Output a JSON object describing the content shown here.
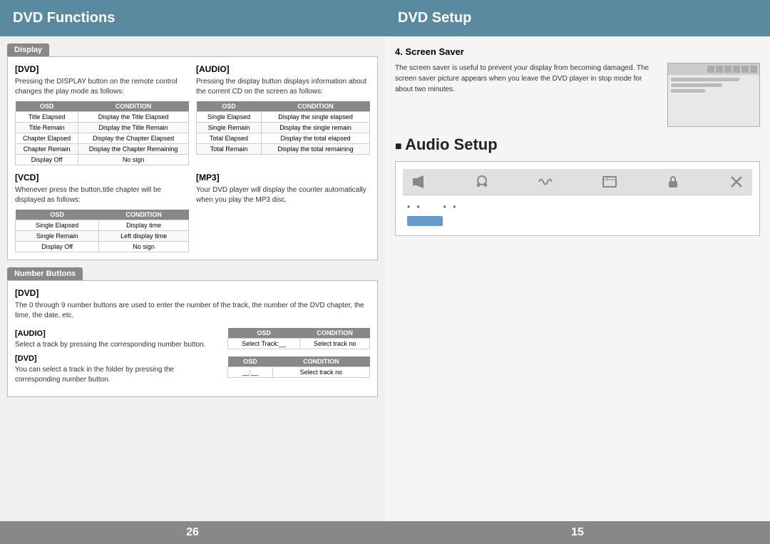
{
  "left": {
    "header": "DVD Functions",
    "display_tab": "Display",
    "dvd_title": "[DVD]",
    "dvd_desc": "Pressing the DISPLAY button on the remote control changes the play mode as follows:",
    "audio_title": "[AUDIO]",
    "audio_desc": "Pressing the display button displays information about the current CD on the screen as follows:",
    "dvd_table": {
      "headers": [
        "OSD",
        "CONDITION"
      ],
      "rows": [
        [
          "Title Elapsed",
          "Display the Title Elapsed"
        ],
        [
          "Title Remain",
          "Display the Title Remain"
        ],
        [
          "Chapter Elapsed",
          "Display the Chapter Elapsed"
        ],
        [
          "Chapter Remain",
          "Display the Chapter Remaining"
        ],
        [
          "Display Off",
          "No sign"
        ]
      ]
    },
    "audio_table": {
      "headers": [
        "OSD",
        "CONDITION"
      ],
      "rows": [
        [
          "Single Elapsed",
          "Display the single elapsed"
        ],
        [
          "Single Remain",
          "Display the single remain"
        ],
        [
          "Total Elapsed",
          "Display the total elapsed"
        ],
        [
          "Total Remain",
          "Display the total remaining"
        ]
      ]
    },
    "vcd_title": "[VCD]",
    "vcd_desc": "Whenever press the button,title chapter will be displayed as follows:",
    "mp3_title": "[MP3]",
    "mp3_desc": "Your DVD player will display the counter automatically when you play the MP3 disc.",
    "vcd_table": {
      "headers": [
        "OSD",
        "CONDITION"
      ],
      "rows": [
        [
          "Single Elapsed",
          "Display time"
        ],
        [
          "Single Remain",
          "Left display time"
        ],
        [
          "Display Off",
          "No sign"
        ]
      ]
    },
    "number_tab": "Number Buttons",
    "num_dvd_title": "[DVD]",
    "num_dvd_desc": "The 0 through 9 number buttons are used to enter the number of the track, the number of the DVD chapter, the time, the date, etc.",
    "num_audio_title": "[AUDIO]",
    "num_audio_desc": "Select a track by pressing the corresponding number button.",
    "num_dvd2_title": "[DVD]",
    "num_dvd2_desc": "You can select a track in the folder by pressing the corresponding number button.",
    "audio_osd_table": {
      "headers": [
        "OSD",
        "CONDITION"
      ],
      "rows": [
        [
          "Select Track:__",
          "Select track no"
        ]
      ]
    },
    "dvd2_osd_table": {
      "headers": [
        "OSD",
        "CONDITION"
      ],
      "rows": [
        [
          "__:__",
          "Select track no"
        ]
      ]
    },
    "footer": "26"
  },
  "right": {
    "header": "DVD Setup",
    "screen_saver_num": "4.",
    "screen_saver_title": "Screen Saver",
    "screen_saver_desc": "The screen saver is useful to prevent your display from becoming damaged. The screen saver picture appears when you leave the DVD player in stop mode for about two minutes.",
    "audio_setup_title": "Audio Setup",
    "audio_dots1": "• •",
    "audio_dots2": "• •",
    "footer": "15"
  }
}
